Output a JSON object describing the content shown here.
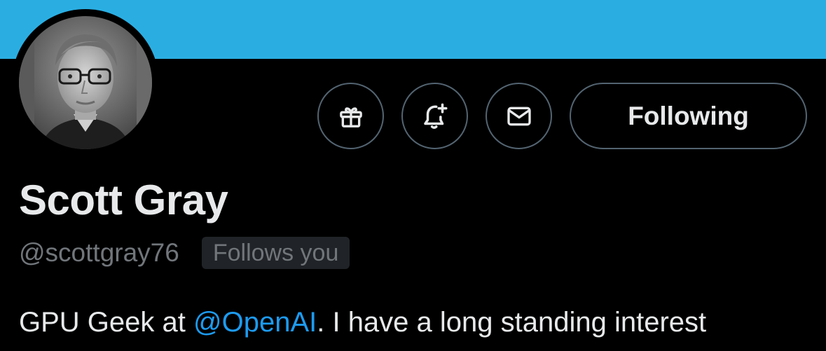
{
  "colors": {
    "banner": "#2aaee2",
    "background": "#000000",
    "text_primary": "#e7e9ea",
    "text_secondary": "#71767b",
    "link": "#1d9bf0",
    "border": "#536471",
    "badge_bg": "#202327"
  },
  "profile": {
    "display_name": "Scott Gray",
    "handle": "@scottgray76",
    "follows_you_badge": "Follows you",
    "avatar_icon": "profile-photo"
  },
  "actions": {
    "subscribe_icon": "gift-icon",
    "notify_icon": "bell-plus-icon",
    "message_icon": "envelope-icon",
    "following_label": "Following"
  },
  "bio": {
    "prefix": "GPU Geek at ",
    "mention": "@OpenAI",
    "suffix": ". I have a long standing interest"
  }
}
